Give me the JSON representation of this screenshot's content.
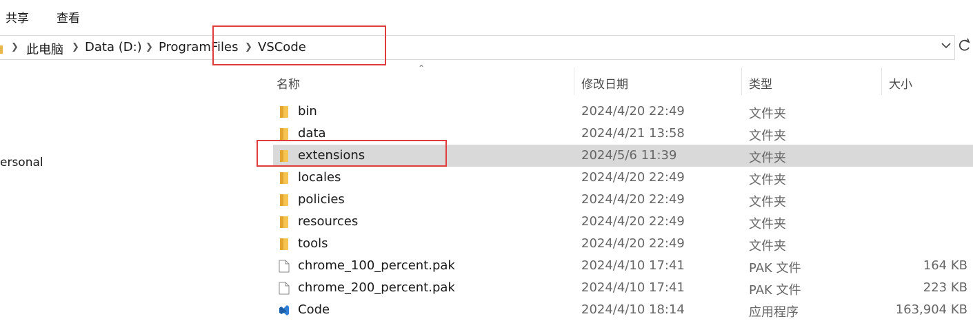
{
  "ribbon": {
    "tabs": [
      "共享",
      "查看"
    ]
  },
  "address": {
    "crumbs": [
      "此电脑",
      "Data (D:)",
      "ProgramFiles",
      "VSCode"
    ]
  },
  "nav": {
    "item_label": "ersonal"
  },
  "columns": {
    "name": "名称",
    "date": "修改日期",
    "type": "类型",
    "size": "大小"
  },
  "files": [
    {
      "name": "bin",
      "date": "2024/4/20 22:49",
      "type": "文件夹",
      "size": "",
      "icon": "folder-icon"
    },
    {
      "name": "data",
      "date": "2024/4/21 13:58",
      "type": "文件夹",
      "size": "",
      "icon": "folder-icon"
    },
    {
      "name": "extensions",
      "date": "2024/5/6 11:39",
      "type": "文件夹",
      "size": "",
      "icon": "folder-icon",
      "selected": true
    },
    {
      "name": "locales",
      "date": "2024/4/20 22:49",
      "type": "文件夹",
      "size": "",
      "icon": "folder-icon"
    },
    {
      "name": "policies",
      "date": "2024/4/20 22:49",
      "type": "文件夹",
      "size": "",
      "icon": "folder-icon"
    },
    {
      "name": "resources",
      "date": "2024/4/20 22:49",
      "type": "文件夹",
      "size": "",
      "icon": "folder-icon"
    },
    {
      "name": "tools",
      "date": "2024/4/20 22:49",
      "type": "文件夹",
      "size": "",
      "icon": "folder-icon"
    },
    {
      "name": "chrome_100_percent.pak",
      "date": "2024/4/10 17:41",
      "type": "PAK 文件",
      "size": "164 KB",
      "icon": "file-icon"
    },
    {
      "name": "chrome_200_percent.pak",
      "date": "2024/4/10 17:41",
      "type": "PAK 文件",
      "size": "223 KB",
      "icon": "file-icon"
    },
    {
      "name": "Code",
      "date": "2024/4/10 18:14",
      "type": "应用程序",
      "size": "163,904 KB",
      "icon": "vscode-icon"
    }
  ],
  "colors": {
    "highlight": "#e03c3c",
    "selected_row": "#d9d9d9",
    "folder": "#e8b64a"
  }
}
